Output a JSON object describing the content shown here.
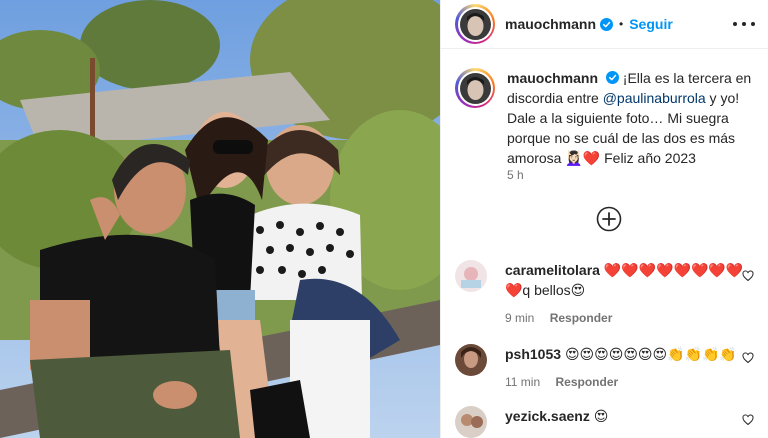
{
  "post": {
    "username": "mauochmann",
    "follow_label": "Seguir",
    "dot": "•"
  },
  "caption": {
    "username": "mauochmann",
    "text_1": "¡Ella es la tercera en discordia entre ",
    "mention": "@paulinaburrola",
    "text_2": " y yo! Dale a la siguiente foto… Mi suegra porque no se cuál de las dos es más amorosa 💆🏻‍♀️❤️ Feliz año 2023",
    "time": "5 h"
  },
  "comments": [
    {
      "username": "caramelitolara",
      "text": "❤️❤️❤️❤️❤️❤️❤️❤️❤️q bellos😍",
      "time": "9 min",
      "reply": "Responder"
    },
    {
      "username": "psh1053",
      "text": "😍😍😍😍😍😍😍👏👏👏👏",
      "time": "11 min",
      "reply": "Responder"
    },
    {
      "username": "yezick.saenz",
      "text": "😍",
      "time": "",
      "reply": ""
    }
  ],
  "colors": {
    "accent": "#0095f6",
    "verified": "#0095f6",
    "mention": "#00376b"
  },
  "icons": [
    "verified-badge-icon",
    "more-options-icon",
    "load-more-icon",
    "heart-icon"
  ]
}
